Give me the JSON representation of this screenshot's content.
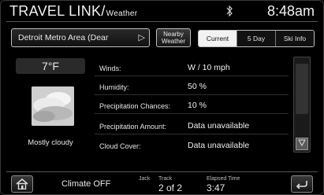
{
  "header": {
    "title": "TRAVEL LINK/",
    "subtitle": "Weather",
    "status_icon": "bluetooth-icon",
    "clock": "8:48am"
  },
  "location": {
    "value": "Detroit Metro Area (Dear",
    "arrow": "▷",
    "nearby_label_1": "Nearby",
    "nearby_label_2": "Weather"
  },
  "tabs": [
    {
      "label": "Current",
      "active": true
    },
    {
      "label": "5 Day",
      "active": false
    },
    {
      "label": "Ski Info",
      "active": false
    }
  ],
  "current": {
    "temperature": "7°F",
    "condition": "Mostly cloudy",
    "icon": "cloud-icon"
  },
  "rows": [
    {
      "label": "Winds:",
      "value": "W / 10 mph"
    },
    {
      "label": "Humidity:",
      "value": "50 %"
    },
    {
      "label": "Precipitation Chances:",
      "value": "10 %"
    },
    {
      "label": "Precipitation Amount:",
      "value": "Data unavailable"
    },
    {
      "label": "Cloud Cover:",
      "value": "Data unavailable"
    }
  ],
  "footer": {
    "home_icon": "home-icon",
    "climate": "Climate OFF",
    "source": "Jack",
    "track_label": "Track",
    "track_value": "2 of 2",
    "elapsed_label": "Elapsed Time",
    "elapsed_value": "3:47",
    "back_icon": "back-arrow-icon"
  },
  "colors": {
    "background": "#000000",
    "text": "#e8e8e8",
    "active_tab_bg": "#f2f2f2"
  }
}
